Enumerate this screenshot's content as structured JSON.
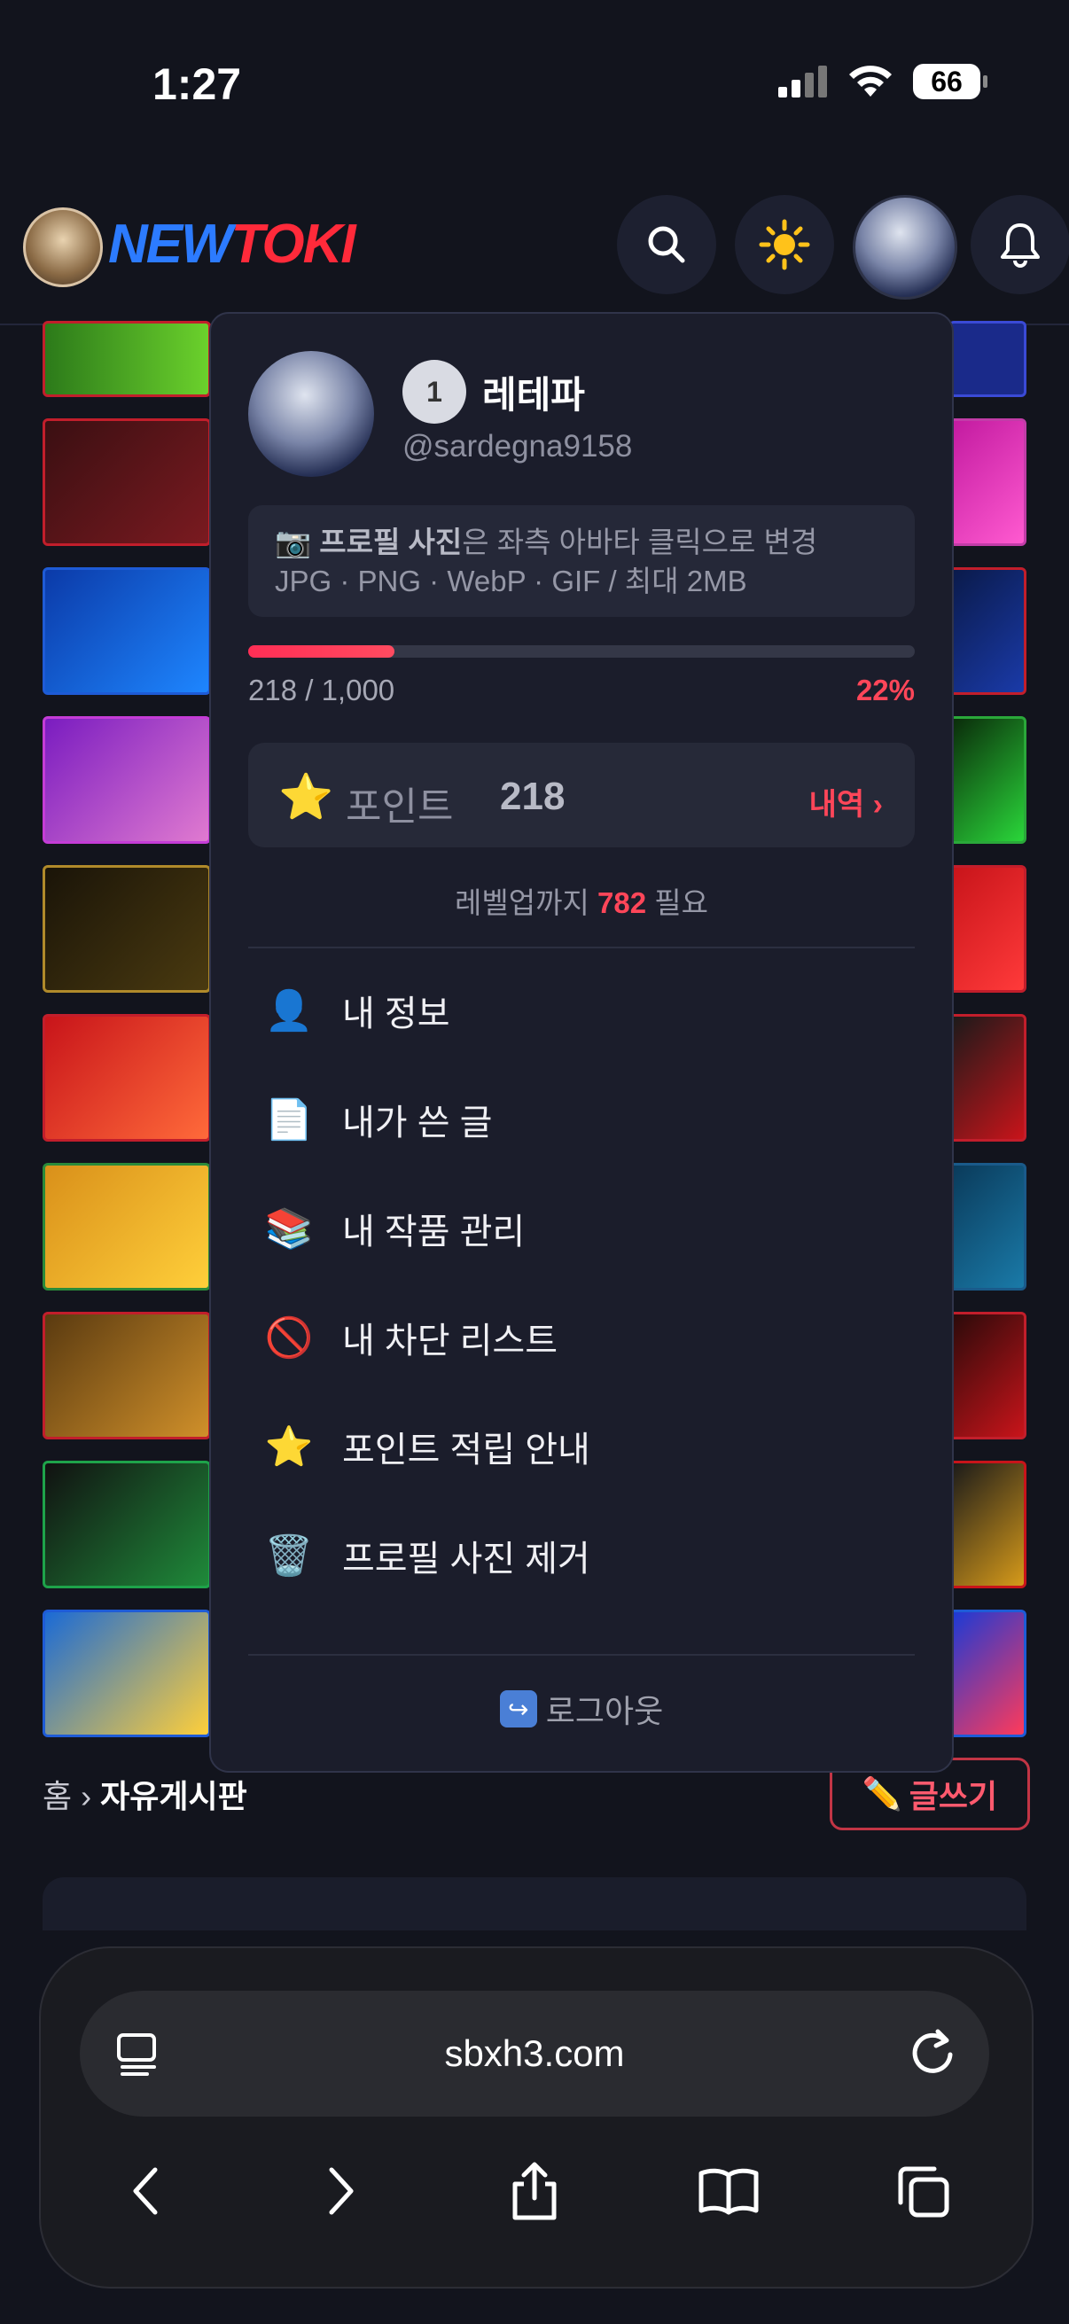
{
  "status": {
    "time": "1:27",
    "battery": "66"
  },
  "header": {
    "logo_part1": "NEW",
    "logo_part2": "TOKI"
  },
  "breadcrumb": {
    "home": "홈",
    "sep": "›",
    "current": "자유게시판"
  },
  "write_button": {
    "icon": "✏️",
    "label": "글쓰기"
  },
  "profile_menu": {
    "level": "1",
    "name": "레테파",
    "handle": "@sardegna9158",
    "hint_icon": "📷",
    "hint_bold": "프로필 사진",
    "hint_rest": "은 좌측 아바타 클릭으로 변경",
    "hint_line2": "JPG · PNG · WebP · GIF / 최대 2MB",
    "progress": {
      "current": "218",
      "max": "1,000",
      "percent_label": "22%",
      "fraction": 0.22
    },
    "points": {
      "icon": "⭐",
      "label": "포인트",
      "value": "218",
      "history": "내역 ›"
    },
    "levelup": {
      "prefix": "레벨업까지",
      "remaining": "782",
      "suffix": "필요"
    },
    "items": [
      {
        "icon": "👤",
        "label": "내 정보"
      },
      {
        "icon": "📄",
        "label": "내가 쓴 글"
      },
      {
        "icon": "📚",
        "label": "내 작품 관리"
      },
      {
        "icon": "🚫",
        "label": "내 차단 리스트"
      },
      {
        "icon": "⭐",
        "label": "포인트 적립 안내"
      },
      {
        "icon": "🗑️",
        "label": "프로필 사진 제거"
      }
    ],
    "logout": {
      "icon": "↪",
      "label": "로그아웃"
    }
  },
  "browser": {
    "url": "sbxh3.com"
  },
  "colors": {
    "accent": "#ff4659",
    "panel": "#1b1d2b",
    "background": "#12141d"
  }
}
